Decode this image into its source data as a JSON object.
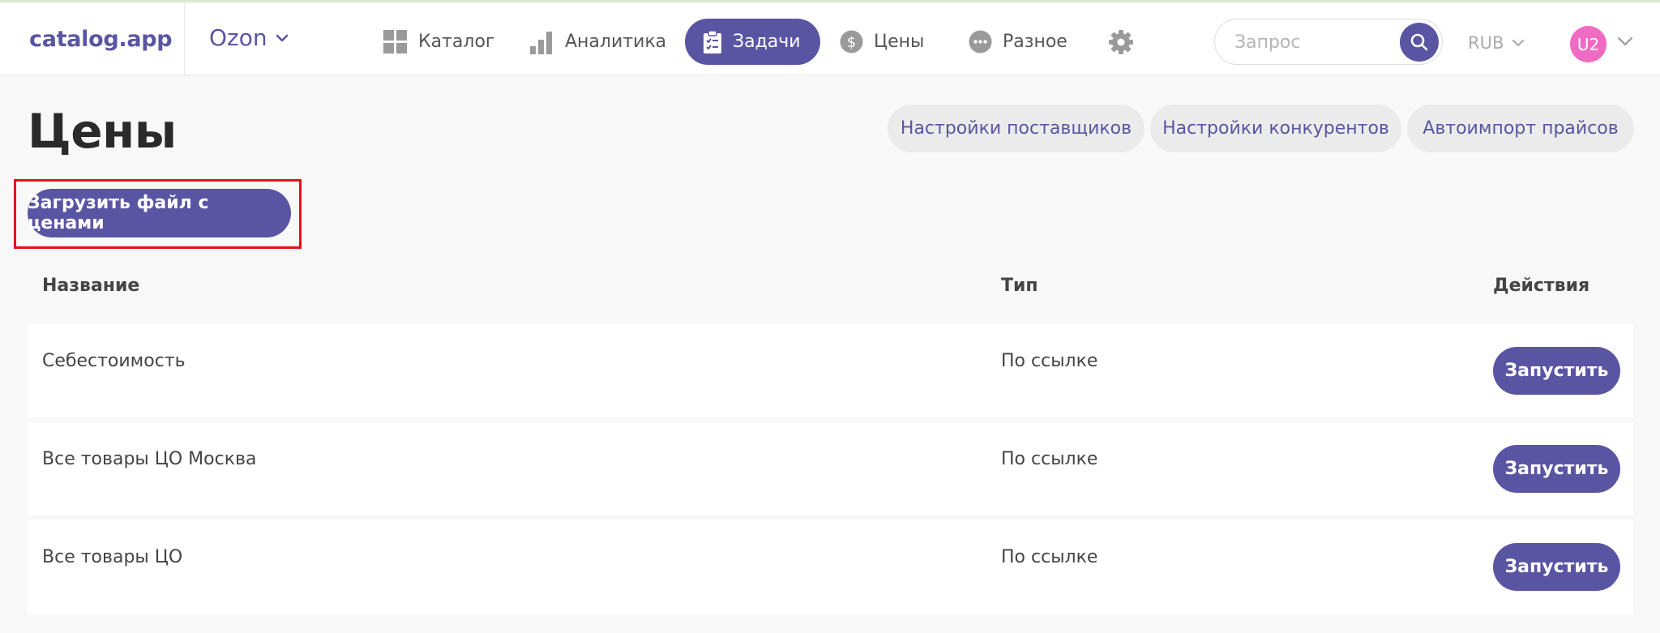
{
  "app": {
    "logo": "catalog.app"
  },
  "store": {
    "name": "Ozon"
  },
  "nav": {
    "catalog": "Каталог",
    "analytics": "Аналитика",
    "tasks": "Задачи",
    "prices": "Цены",
    "misc": "Разное"
  },
  "search": {
    "placeholder": "Запрос",
    "value": ""
  },
  "currency": {
    "selected": "RUB"
  },
  "user": {
    "initials": "U2"
  },
  "page": {
    "title": "Цены",
    "upload_label": "Загрузить файл с ценами",
    "actions": [
      "Настройки поставщиков",
      "Настройки конкурентов",
      "Автоимпорт прайсов"
    ]
  },
  "table": {
    "headers": {
      "name": "Название",
      "type": "Тип",
      "actions": "Действия"
    },
    "rows": [
      {
        "name": "Себестоимость",
        "type": "По ссылке",
        "action": "Запустить"
      },
      {
        "name": "Все товары ЦО Москва",
        "type": "По ссылке",
        "action": "Запустить"
      },
      {
        "name": "Все товары ЦО",
        "type": "По ссылке",
        "action": "Запустить"
      }
    ]
  },
  "colors": {
    "accent": "#5a55a3",
    "highlight": "#e8101c",
    "avatar": "#f06bc4",
    "pill_bg": "#ebebeb"
  }
}
